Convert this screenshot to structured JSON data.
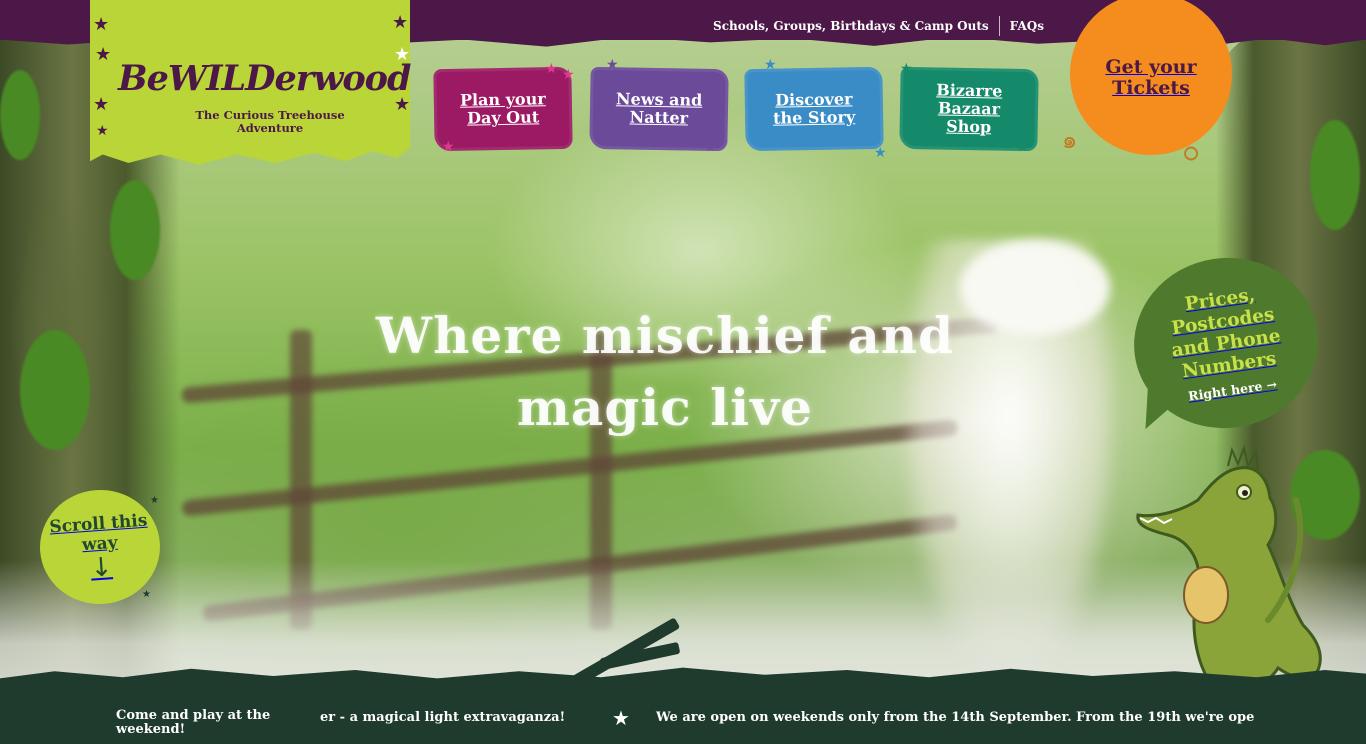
{
  "brand": {
    "name": "BeWILDerwood",
    "tagline": "The Curious Treehouse Adventure"
  },
  "top_links": [
    "Schools, Groups, Birthdays & Camp Outs",
    "FAQs"
  ],
  "nav": [
    {
      "label": "Plan your Day Out",
      "color": "#9c1a64"
    },
    {
      "label": "News and Natter",
      "color": "#6b4a9a"
    },
    {
      "label": "Discover the Story",
      "color": "#3a8cc6"
    },
    {
      "label": "Bizarre Bazaar Shop",
      "color": "#158a6a"
    }
  ],
  "tickets": {
    "label": "Get your Tickets",
    "color": "#f48c1e"
  },
  "hero": {
    "headline": "Where mischief and magic live"
  },
  "prices": {
    "title": "Prices, Postcodes and Phone Numbers",
    "link": "Right here →"
  },
  "scroll": {
    "label": "Scroll this way",
    "arrow": "↓"
  },
  "ticker": {
    "lead": "Come and play at the weekend!",
    "item1": "er - a magical light extravaganza!",
    "separator": "★",
    "item2": "We are open on weekends only from the 14th September. From the 19th we're ope"
  },
  "colors": {
    "purple": "#4b1848",
    "lime": "#b9d537",
    "dark_green": "#1f3b2e",
    "orange": "#f48c1e"
  },
  "icons": [
    "star-icon",
    "right-arrow-icon",
    "down-arrow-icon",
    "crocodile-mascot"
  ]
}
